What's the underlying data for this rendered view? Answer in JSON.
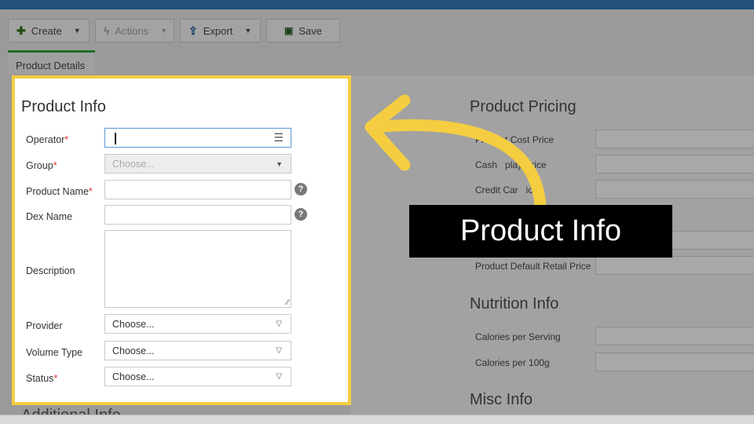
{
  "toolbar": {
    "create_label": "Create",
    "actions_label": "Actions",
    "export_label": "Export",
    "save_label": "Save"
  },
  "tabs": [
    {
      "label": "Product Details"
    }
  ],
  "product_info": {
    "title": "Product Info",
    "fields": {
      "operator": {
        "label": "Operator",
        "required_mark": "*",
        "value": ""
      },
      "group": {
        "label": "Group",
        "required_mark": "*",
        "placeholder": "Choose..."
      },
      "product_name": {
        "label": "Product Name",
        "required_mark": "*",
        "value": ""
      },
      "dex_name": {
        "label": "Dex Name",
        "value": ""
      },
      "description": {
        "label": "Description",
        "value": ""
      },
      "provider": {
        "label": "Provider",
        "value": "Choose..."
      },
      "volume_type": {
        "label": "Volume Type",
        "value": "Choose..."
      },
      "status": {
        "label": "Status",
        "required_mark": "*",
        "value": "Choose..."
      }
    },
    "help_glyph": "?"
  },
  "additional_info": {
    "title": "Additional Info"
  },
  "product_pricing": {
    "title": "Product Pricing",
    "labels": [
      "Product Cost Price",
      "Cash   play Price",
      "Credit Car   ice"
    ]
  },
  "default_retail": {
    "label": "Product Default Retail Price"
  },
  "nutrition_info": {
    "title": "Nutrition Info",
    "labels": [
      "Calories per Serving",
      "Calories per 100g"
    ]
  },
  "misc_info": {
    "title": "Misc Info"
  },
  "callout": {
    "text": "Product Info"
  },
  "colors": {
    "highlight_border": "#f4cd41",
    "arrow": "#f4cd41",
    "top_bar": "#23507a",
    "required": "#d9342b",
    "tab_accent": "#1f6d2a"
  },
  "icons": {
    "create": "plus-icon",
    "actions": "lightning-icon",
    "export": "upload-icon",
    "save": "save-icon",
    "operator_picker": "list-icon",
    "help": "question-circle-icon"
  }
}
